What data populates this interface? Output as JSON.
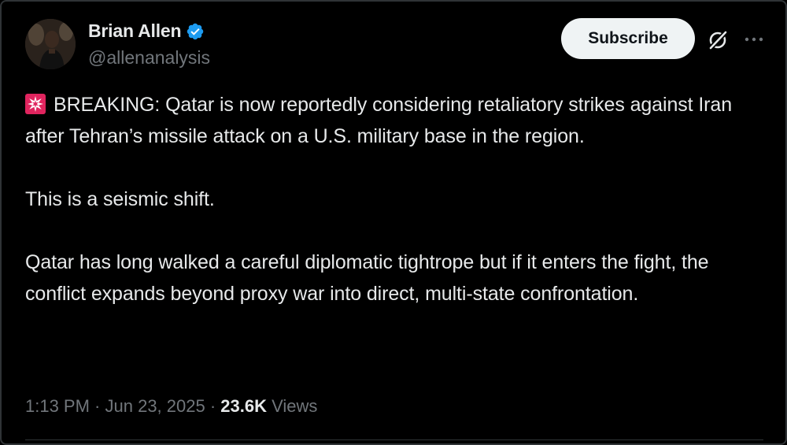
{
  "author": {
    "display_name": "Brian Allen",
    "handle": "@allenanalysis",
    "verified": true,
    "verified_color": "#1d9bf0"
  },
  "actions": {
    "subscribe_label": "Subscribe",
    "grok_icon": "grok-icon",
    "more_icon": "more-horizontal-icon"
  },
  "tweet": {
    "emoji": "siren-emoji",
    "paragraphs": [
      "BREAKING: Qatar is now reportedly considering retaliatory strikes against Iran after Tehran’s missile attack on a U.S. military base in the region.",
      "This is a seismic shift.",
      "Qatar has long walked a careful diplomatic tightrope but if it enters the fight, the conflict expands beyond proxy war into direct, multi-state confrontation."
    ]
  },
  "meta": {
    "time": "1:13 PM",
    "separator": " · ",
    "date": "Jun 23, 2025",
    "views_count": "23.6K",
    "views_label": "Views"
  },
  "colors": {
    "background": "#000000",
    "text_primary": "#e7e9ea",
    "text_secondary": "#71767b",
    "button_bg": "#eff3f4",
    "border": "#2f3336"
  }
}
